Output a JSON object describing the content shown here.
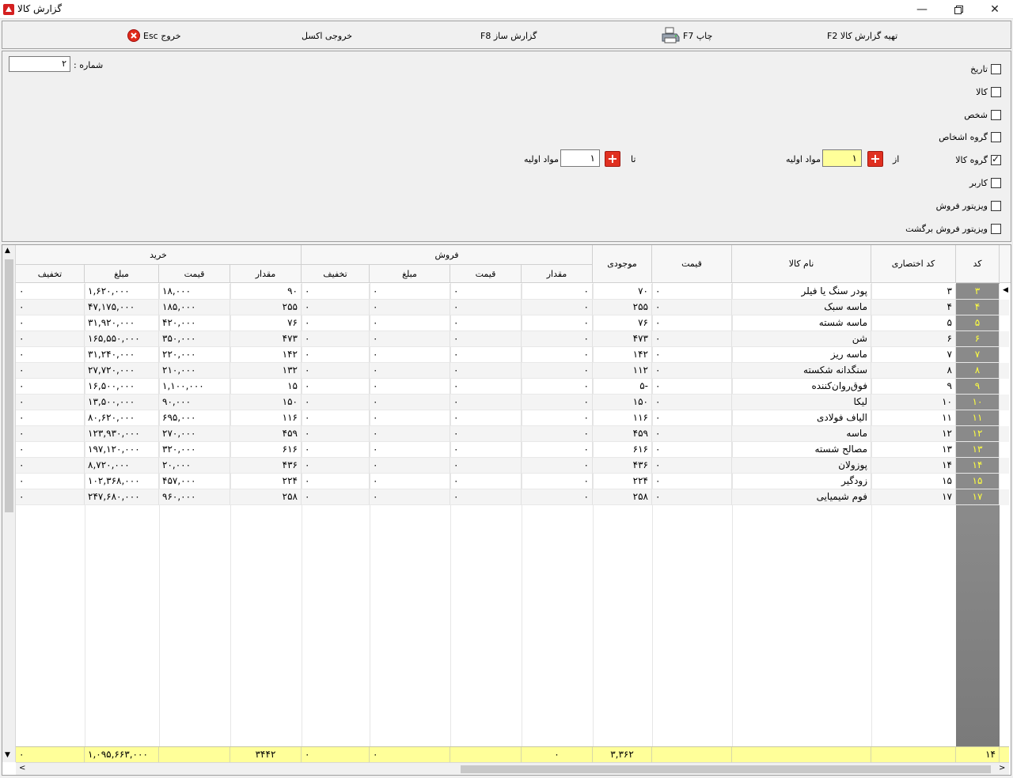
{
  "window": {
    "title": "گزارش کالا"
  },
  "toolbar": {
    "prepare": "تهیه گزارش کالا F2",
    "print": "چاپ F7",
    "builder": "گزارش ساز F8",
    "excel": "خروجی اکسل",
    "exit": "خروج Esc"
  },
  "filters": {
    "number_label": "شماره :",
    "number_value": "۲",
    "checkboxes": [
      {
        "label": "تاریخ",
        "checked": false
      },
      {
        "label": "کالا",
        "checked": false
      },
      {
        "label": "شخص",
        "checked": false
      },
      {
        "label": "گروه اشخاص",
        "checked": false
      },
      {
        "label": "گروه کالا",
        "checked": true
      },
      {
        "label": "کاربر",
        "checked": false
      },
      {
        "label": "ویزیتور فروش",
        "checked": false
      },
      {
        "label": "ویزیتور فروش برگشت",
        "checked": false
      }
    ],
    "from_label": "از",
    "to_label": "تا",
    "from_value": "۱",
    "to_value": "۱",
    "from_group_name": "مواد اولیه",
    "to_group_name": "مواد اولیه"
  },
  "grid": {
    "headers": {
      "code": "کد",
      "short_code": "کد اختصاری",
      "name": "نام کالا",
      "price": "قیمت",
      "stock": "موجودی",
      "sales_group": "فروش",
      "purchase_group": "خرید",
      "qty": "مقدار",
      "unit_price": "قیمت",
      "amount": "مبلغ",
      "discount": "تخفیف"
    },
    "rows": [
      {
        "code": "۳",
        "short": "۳",
        "name": "پودر سنگ یا فیلر",
        "price": "۰",
        "stock": "۷۰",
        "s_qty": "۰",
        "s_price": "۰",
        "s_amt": "۰",
        "s_disc": "۰",
        "p_qty": "۹۰",
        "p_price": "۱۸,۰۰۰",
        "p_amt": "۱,۶۲۰,۰۰۰",
        "p_disc": "۰"
      },
      {
        "code": "۴",
        "short": "۴",
        "name": "ماسه سبک",
        "price": "۰",
        "stock": "۲۵۵",
        "s_qty": "۰",
        "s_price": "۰",
        "s_amt": "۰",
        "s_disc": "۰",
        "p_qty": "۲۵۵",
        "p_price": "۱۸۵,۰۰۰",
        "p_amt": "۴۷,۱۷۵,۰۰۰",
        "p_disc": "۰"
      },
      {
        "code": "۵",
        "short": "۵",
        "name": "ماسه شسته",
        "price": "۰",
        "stock": "۷۶",
        "s_qty": "۰",
        "s_price": "۰",
        "s_amt": "۰",
        "s_disc": "۰",
        "p_qty": "۷۶",
        "p_price": "۴۲۰,۰۰۰",
        "p_amt": "۳۱,۹۲۰,۰۰۰",
        "p_disc": "۰"
      },
      {
        "code": "۶",
        "short": "۶",
        "name": "شن",
        "price": "۰",
        "stock": "۴۷۳",
        "s_qty": "۰",
        "s_price": "۰",
        "s_amt": "۰",
        "s_disc": "۰",
        "p_qty": "۴۷۳",
        "p_price": "۳۵۰,۰۰۰",
        "p_amt": "۱۶۵,۵۵۰,۰۰۰",
        "p_disc": "۰"
      },
      {
        "code": "۷",
        "short": "۷",
        "name": "ماسه ریز",
        "price": "۰",
        "stock": "۱۴۲",
        "s_qty": "۰",
        "s_price": "۰",
        "s_amt": "۰",
        "s_disc": "۰",
        "p_qty": "۱۴۲",
        "p_price": "۲۲۰,۰۰۰",
        "p_amt": "۳۱,۲۴۰,۰۰۰",
        "p_disc": "۰"
      },
      {
        "code": "۸",
        "short": "۸",
        "name": "سنگدانه شکسته",
        "price": "۰",
        "stock": "۱۱۲",
        "s_qty": "۰",
        "s_price": "۰",
        "s_amt": "۰",
        "s_disc": "۰",
        "p_qty": "۱۳۲",
        "p_price": "۲۱۰,۰۰۰",
        "p_amt": "۲۷,۷۲۰,۰۰۰",
        "p_disc": "۰"
      },
      {
        "code": "۹",
        "short": "۹",
        "name": "فوق‌روان‌کننده",
        "price": "۰",
        "stock": "-۵",
        "s_qty": "۰",
        "s_price": "۰",
        "s_amt": "۰",
        "s_disc": "۰",
        "p_qty": "۱۵",
        "p_price": "۱,۱۰۰,۰۰۰",
        "p_amt": "۱۶,۵۰۰,۰۰۰",
        "p_disc": "۰"
      },
      {
        "code": "۱۰",
        "short": "۱۰",
        "name": "لیکا",
        "price": "۰",
        "stock": "۱۵۰",
        "s_qty": "۰",
        "s_price": "۰",
        "s_amt": "۰",
        "s_disc": "۰",
        "p_qty": "۱۵۰",
        "p_price": "۹۰,۰۰۰",
        "p_amt": "۱۳,۵۰۰,۰۰۰",
        "p_disc": "۰"
      },
      {
        "code": "۱۱",
        "short": "۱۱",
        "name": "الیاف فولادی",
        "price": "۰",
        "stock": "۱۱۶",
        "s_qty": "۰",
        "s_price": "۰",
        "s_amt": "۰",
        "s_disc": "۰",
        "p_qty": "۱۱۶",
        "p_price": "۶۹۵,۰۰۰",
        "p_amt": "۸۰,۶۲۰,۰۰۰",
        "p_disc": "۰"
      },
      {
        "code": "۱۲",
        "short": "۱۲",
        "name": "ماسه",
        "price": "۰",
        "stock": "۴۵۹",
        "s_qty": "۰",
        "s_price": "۰",
        "s_amt": "۰",
        "s_disc": "۰",
        "p_qty": "۴۵۹",
        "p_price": "۲۷۰,۰۰۰",
        "p_amt": "۱۲۳,۹۳۰,۰۰۰",
        "p_disc": "۰"
      },
      {
        "code": "۱۳",
        "short": "۱۳",
        "name": "مصالح شسته",
        "price": "۰",
        "stock": "۶۱۶",
        "s_qty": "۰",
        "s_price": "۰",
        "s_amt": "۰",
        "s_disc": "۰",
        "p_qty": "۶۱۶",
        "p_price": "۳۲۰,۰۰۰",
        "p_amt": "۱۹۷,۱۲۰,۰۰۰",
        "p_disc": "۰"
      },
      {
        "code": "۱۴",
        "short": "۱۴",
        "name": "پوزولان",
        "price": "۰",
        "stock": "۴۳۶",
        "s_qty": "۰",
        "s_price": "۰",
        "s_amt": "۰",
        "s_disc": "۰",
        "p_qty": "۴۳۶",
        "p_price": "۲۰,۰۰۰",
        "p_amt": "۸,۷۲۰,۰۰۰",
        "p_disc": "۰"
      },
      {
        "code": "۱۵",
        "short": "۱۵",
        "name": "زودگیر",
        "price": "۰",
        "stock": "۲۲۴",
        "s_qty": "۰",
        "s_price": "۰",
        "s_amt": "۰",
        "s_disc": "۰",
        "p_qty": "۲۲۴",
        "p_price": "۴۵۷,۰۰۰",
        "p_amt": "۱۰۲,۳۶۸,۰۰۰",
        "p_disc": "۰"
      },
      {
        "code": "۱۷",
        "short": "۱۷",
        "name": "فوم شیمیایی",
        "price": "۰",
        "stock": "۲۵۸",
        "s_qty": "۰",
        "s_price": "۰",
        "s_amt": "۰",
        "s_disc": "۰",
        "p_qty": "۲۵۸",
        "p_price": "۹۶۰,۰۰۰",
        "p_amt": "۲۴۷,۶۸۰,۰۰۰",
        "p_disc": "۰"
      }
    ],
    "footer": {
      "count": "۱۴",
      "stock_total": "۳,۳۶۲",
      "s_qty_total": "۰",
      "s_amt_total": "۰",
      "s_disc_total": "۰",
      "p_qty_total": "۳۴۴۲",
      "p_amt_total": "۱,۰۹۵,۶۶۳,۰۰۰",
      "p_disc_total": "۰"
    }
  },
  "colors": {
    "id_column_bg": "#8a8a8a",
    "id_column_text": "#ffff40",
    "footer_bg": "#ffff99",
    "plus_button": "#e03020"
  }
}
